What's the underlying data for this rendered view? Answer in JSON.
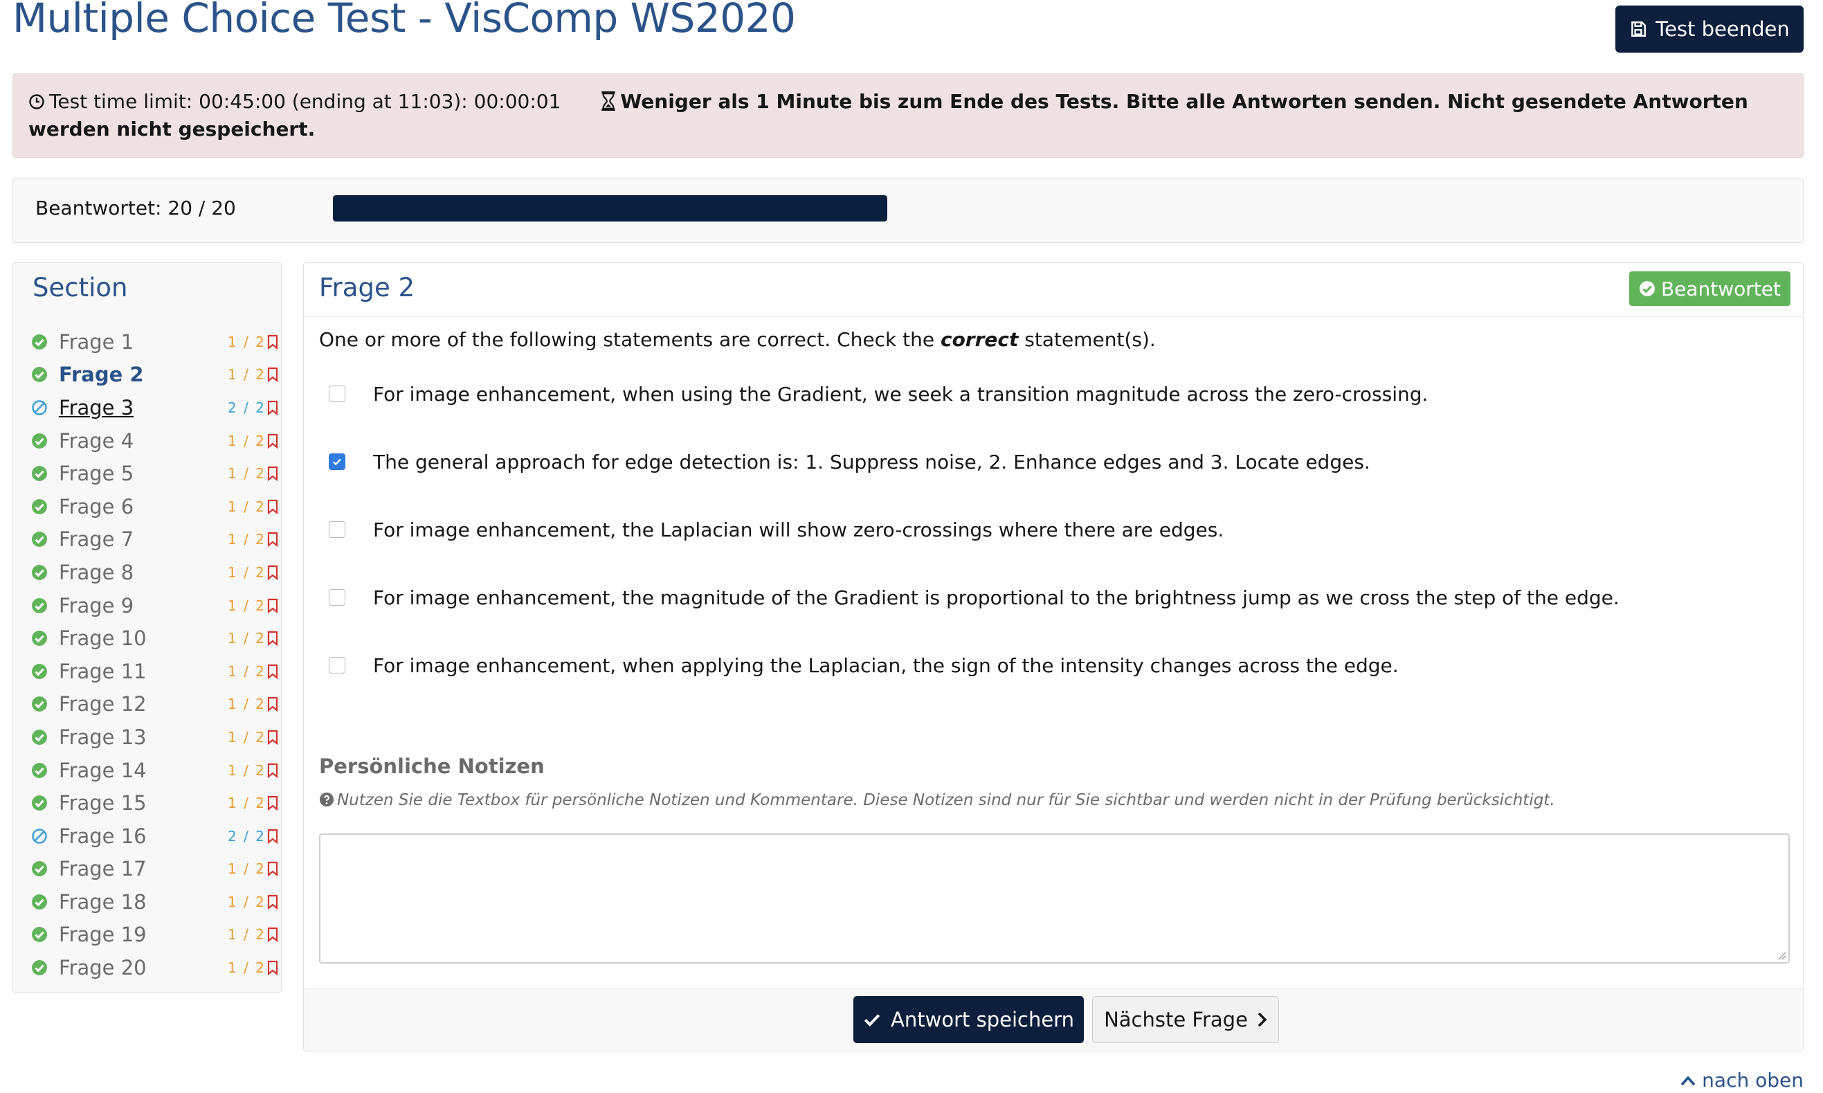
{
  "header": {
    "title": "Multiple Choice Test - VisComp WS2020",
    "end_button": "Test beenden"
  },
  "alert": {
    "time_text": "Test time limit: 00:45:00 (ending at 11:03): 00:00:01",
    "warning_text": "Weniger als 1 Minute bis zum Ende des Tests. Bitte alle Antworten senden. Nicht gesendete Antworten werden nicht gespeichert."
  },
  "progress": {
    "label": "Beantwortet: 20 / 20",
    "answered": 20,
    "total": 20
  },
  "sidebar": {
    "title": "Section",
    "items": [
      {
        "label": "Frage 1",
        "points": "1 / 2",
        "status": "answered"
      },
      {
        "label": "Frage 2",
        "points": "1 / 2",
        "status": "answered",
        "active": true
      },
      {
        "label": "Frage 3",
        "points": "2 / 2",
        "status": "skipped",
        "hover": true
      },
      {
        "label": "Frage 4",
        "points": "1 / 2",
        "status": "answered"
      },
      {
        "label": "Frage 5",
        "points": "1 / 2",
        "status": "answered"
      },
      {
        "label": "Frage 6",
        "points": "1 / 2",
        "status": "answered"
      },
      {
        "label": "Frage 7",
        "points": "1 / 2",
        "status": "answered"
      },
      {
        "label": "Frage 8",
        "points": "1 / 2",
        "status": "answered"
      },
      {
        "label": "Frage 9",
        "points": "1 / 2",
        "status": "answered"
      },
      {
        "label": "Frage 10",
        "points": "1 / 2",
        "status": "answered"
      },
      {
        "label": "Frage 11",
        "points": "1 / 2",
        "status": "answered"
      },
      {
        "label": "Frage 12",
        "points": "1 / 2",
        "status": "answered"
      },
      {
        "label": "Frage 13",
        "points": "1 / 2",
        "status": "answered"
      },
      {
        "label": "Frage 14",
        "points": "1 / 2",
        "status": "answered"
      },
      {
        "label": "Frage 15",
        "points": "1 / 2",
        "status": "answered"
      },
      {
        "label": "Frage 16",
        "points": "2 / 2",
        "status": "skipped"
      },
      {
        "label": "Frage 17",
        "points": "1 / 2",
        "status": "answered"
      },
      {
        "label": "Frage 18",
        "points": "1 / 2",
        "status": "answered"
      },
      {
        "label": "Frage 19",
        "points": "1 / 2",
        "status": "answered"
      },
      {
        "label": "Frage 20",
        "points": "1 / 2",
        "status": "answered"
      }
    ]
  },
  "question": {
    "title": "Frage 2",
    "badge": "Beantwortet",
    "prompt_before": "One or more of the following statements are correct. Check the ",
    "prompt_emphasis": "correct",
    "prompt_after": " statement(s).",
    "answers": [
      {
        "text": "For image enhancement, when using the Gradient, we seek a transition magnitude across the zero-crossing.",
        "checked": false
      },
      {
        "text": "The general approach for edge detection is: 1. Suppress noise, 2. Enhance edges and 3. Locate edges.",
        "checked": true
      },
      {
        "text": "For image enhancement, the Laplacian will show zero-crossings where there are edges.",
        "checked": false
      },
      {
        "text": "For image enhancement, the magnitude of the Gradient is proportional to the brightness jump as we cross the step of the edge.",
        "checked": false
      },
      {
        "text": "For image enhancement, when applying the Laplacian, the sign of the intensity changes across the edge.",
        "checked": false
      }
    ]
  },
  "notes": {
    "title": "Persönliche Notizen",
    "help": "Nutzen Sie die Textbox für persönliche Notizen und Kommentare. Diese Notizen sind nur für Sie sichtbar und werden nicht in der Prüfung berücksichtigt.",
    "value": ""
  },
  "footer": {
    "save_button": "Antwort speichern",
    "next_button": "Nächste Frage"
  },
  "to_top": "nach oben",
  "colors": {
    "brand": "#2b5389",
    "navy": "#0d1f3c",
    "success": "#62b45b",
    "alert_bg": "#f0e2e2",
    "points_orange": "#e89c2e",
    "points_blue": "#3a9fd2",
    "checkbox_blue": "#2f7be0"
  }
}
